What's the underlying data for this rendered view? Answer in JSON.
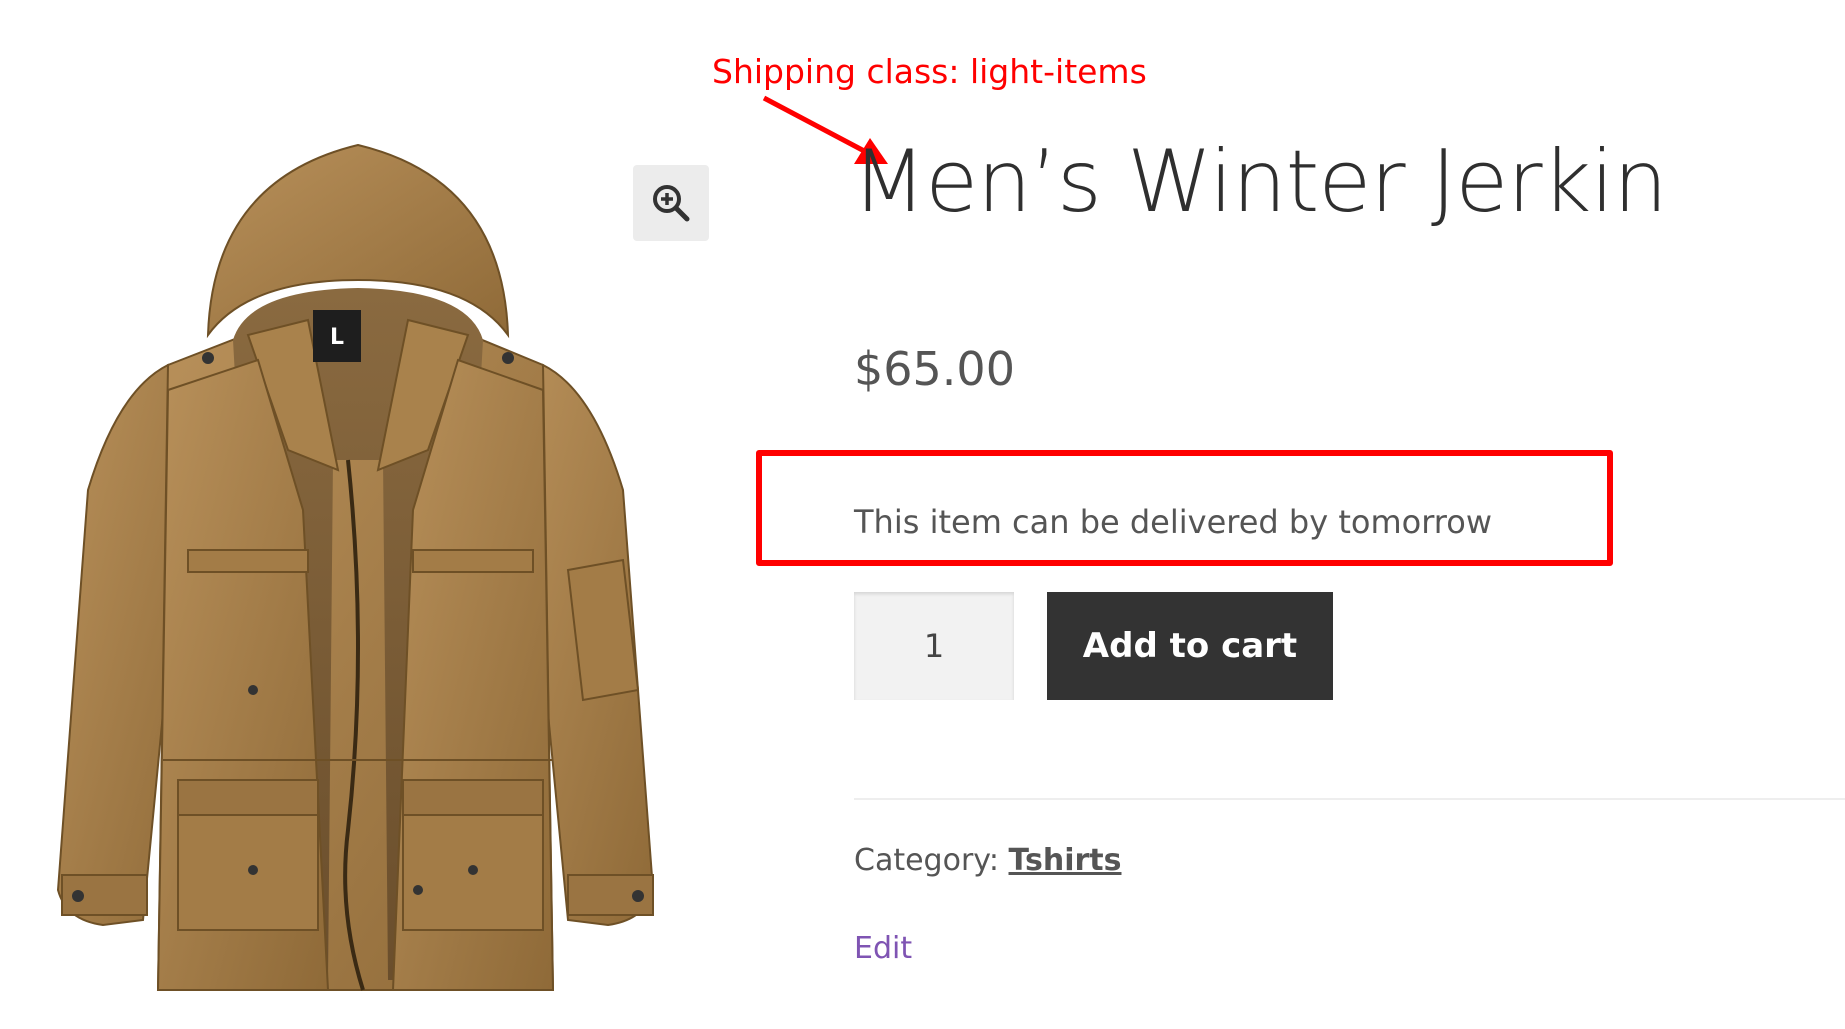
{
  "annotation": {
    "label": "Shipping class: light-items",
    "color": "#ff0000"
  },
  "product": {
    "title": "Men’s Winter Jerkin",
    "price": "$65.00",
    "delivery_message": "This item can be delivered by tomorrow",
    "quantity": "1",
    "add_to_cart_label": "Add to cart",
    "category_label": "Category:",
    "category_value": "Tshirts",
    "edit_label": "Edit",
    "image_icon": "jacket-image",
    "zoom_icon": "zoom-in-icon",
    "size_tag_text": "L"
  },
  "colors": {
    "title": "#2f2f2f",
    "text": "#555555",
    "button_bg": "#333333",
    "button_text": "#ffffff",
    "edit_link": "#7f54b3",
    "highlight_box": "#ff0000"
  }
}
